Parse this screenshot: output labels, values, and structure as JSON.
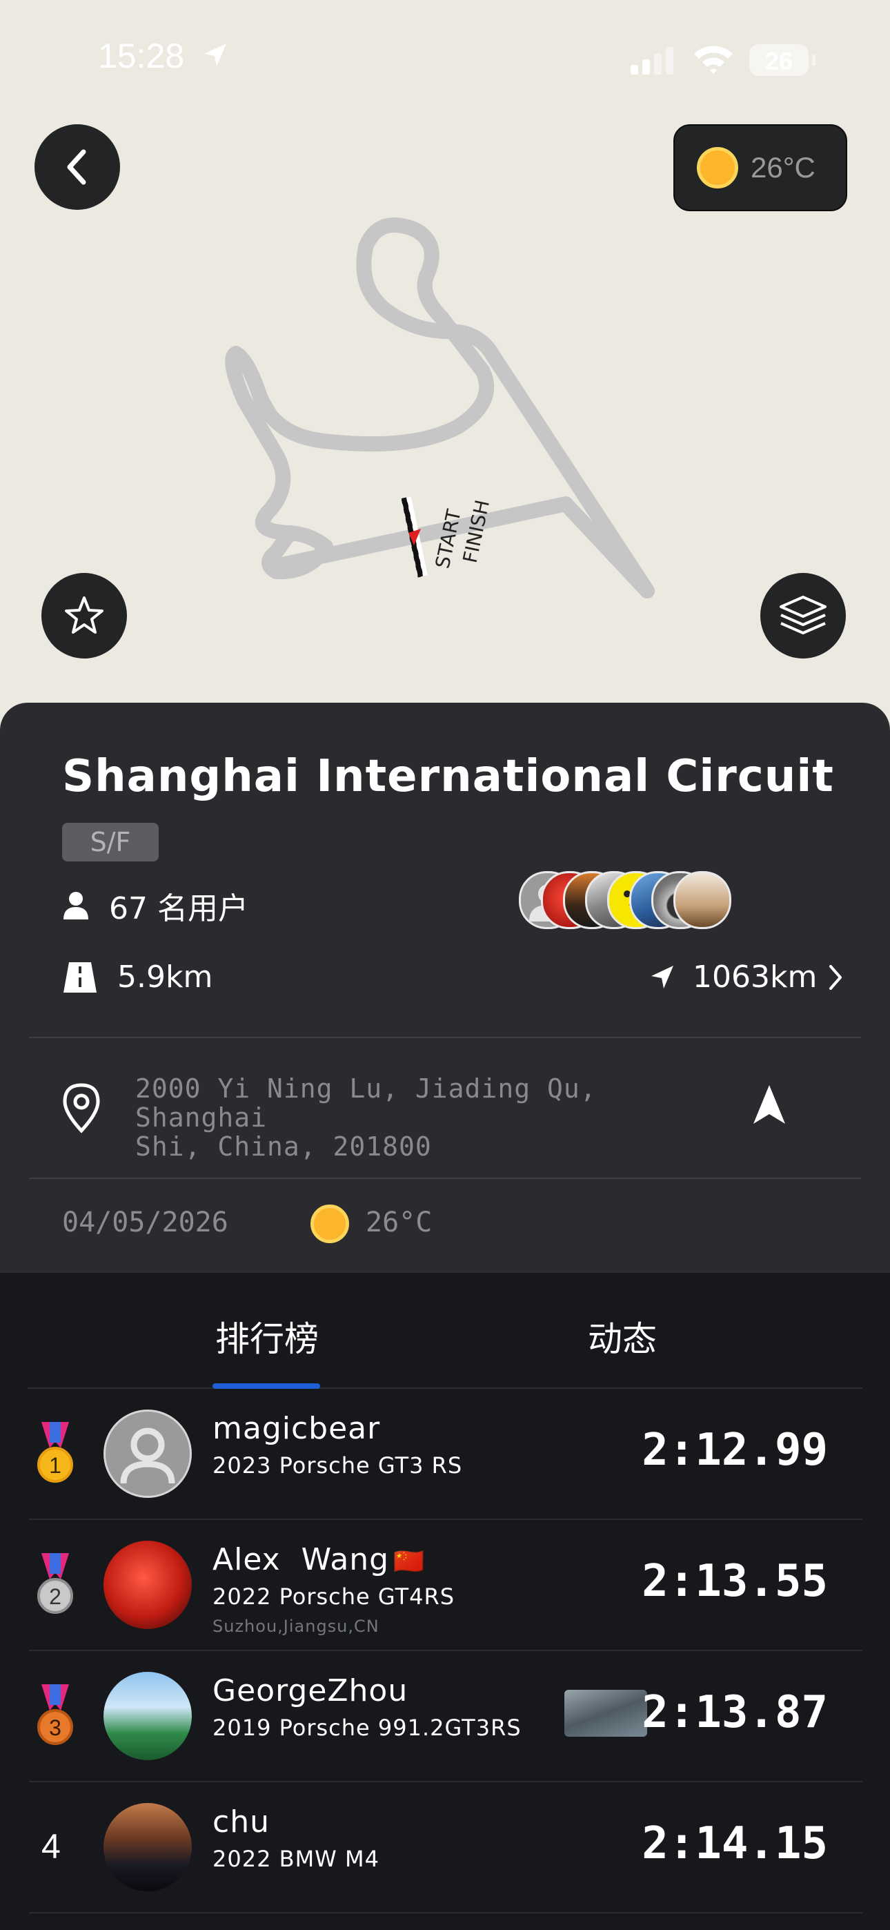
{
  "status_bar": {
    "time": "15:28",
    "battery": "26"
  },
  "map": {
    "weather_temp": "26°C",
    "start_label": "START",
    "finish_label": "FINISH"
  },
  "circuit": {
    "name": "Shanghai International Circuit",
    "tag": "S/F",
    "users": "67 名用户",
    "length": "5.9km",
    "distance": "1063km",
    "address_line1": "2000 Yi Ning Lu, Jiading Qu, Shanghai",
    "address_line2": "Shi, China, 201800",
    "date": "04/05/2026",
    "temp": "26°C"
  },
  "tabs": {
    "leaderboard": "排行榜",
    "activity": "动态"
  },
  "leaderboard": [
    {
      "rank": "1",
      "name": "magicbear",
      "car": "2023 Porsche GT3 RS",
      "location": "",
      "time": "2:12.99"
    },
    {
      "rank": "2",
      "name": "Alex  Wang",
      "flag": "🇨🇳",
      "car": "2022 Porsche GT4RS",
      "location": "Suzhou,Jiangsu,CN",
      "time": "2:13.55"
    },
    {
      "rank": "3",
      "name": "GeorgeZhou",
      "car": "2019 Porsche 991.2GT3RS",
      "location": "",
      "time": "2:13.87"
    },
    {
      "rank": "4",
      "name": "chu",
      "car": "2022 BMW M4",
      "location": "",
      "time": "2:14.15"
    }
  ],
  "colors": {
    "accent": "#1e5fd6",
    "sun": "#fbb62b",
    "card": "#2b2b2f",
    "board": "#16181c"
  }
}
